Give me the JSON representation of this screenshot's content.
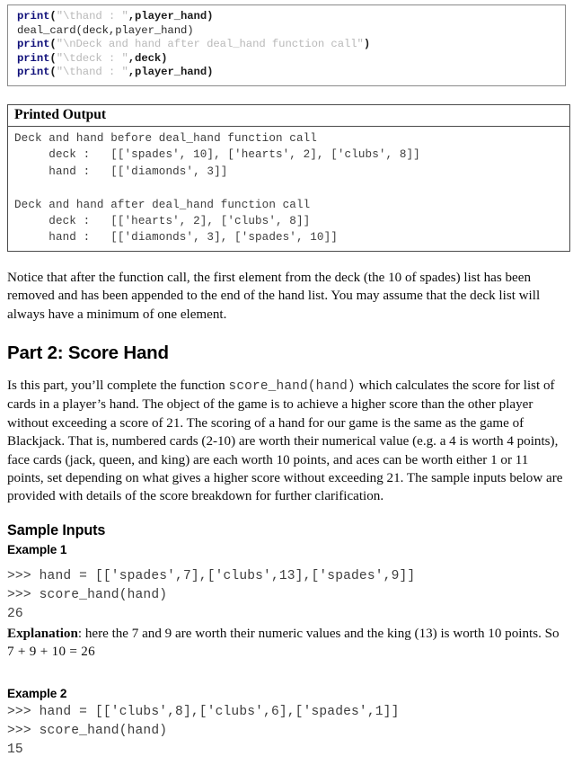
{
  "document": {
    "type": "programming-assignment-handout"
  },
  "code_block": {
    "name": "source-code-snippet",
    "lines": [
      {
        "segments": [
          {
            "text": "print",
            "style": "kw"
          },
          {
            "text": "(",
            "style": "plain"
          },
          {
            "text": "\"\\thand : \"",
            "style": "str"
          },
          {
            "text": ",player_hand)",
            "style": "plain"
          }
        ]
      },
      {
        "segments": [
          {
            "text": "deal_card(deck,player_hand)",
            "style": "plain-n"
          }
        ]
      },
      {
        "segments": [
          {
            "text": "print",
            "style": "kw"
          },
          {
            "text": "(",
            "style": "plain"
          },
          {
            "text": "\"\\nDeck and hand after deal_hand function call\"",
            "style": "str"
          },
          {
            "text": ")",
            "style": "plain"
          }
        ]
      },
      {
        "segments": [
          {
            "text": "print",
            "style": "kw"
          },
          {
            "text": "(",
            "style": "plain"
          },
          {
            "text": "\"\\tdeck : \"",
            "style": "str"
          },
          {
            "text": ",deck)",
            "style": "plain"
          }
        ]
      },
      {
        "segments": [
          {
            "text": "print",
            "style": "kw"
          },
          {
            "text": "(",
            "style": "plain"
          },
          {
            "text": "\"\\thand : \"",
            "style": "str"
          },
          {
            "text": ",player_hand)",
            "style": "plain"
          }
        ]
      }
    ]
  },
  "printed_output": {
    "header": "Printed Output",
    "lines": [
      "Deck and hand before deal_hand function call",
      "     deck :   [['spades', 10], ['hearts', 2], ['clubs', 8]]",
      "     hand :   [['diamonds', 3]]",
      "",
      "Deck and hand after deal_hand function call",
      "     deck :   [['hearts', 2], ['clubs', 8]]",
      "     hand :   [['diamonds', 3], ['spades', 10]]"
    ]
  },
  "notice_paragraph": "Notice that after the function call, the first element from the deck (the 10 of spades) list has been removed and has been appended to the end of the hand list. You may assume that the deck list will always have a minimum of one element.",
  "part2": {
    "heading": "Part 2: Score Hand",
    "intro_before_code": "Is this part, you’ll complete the function ",
    "inline_code": "score_hand(hand)",
    "intro_after_code": "  which calculates the score for list of cards in a player’s hand. The object of the game is to achieve a higher score than the other player without exceeding a score of 21. The scoring of a hand for our game is the same as the game of Blackjack. That is, numbered cards (2-10) are worth their numerical value (e.g. a 4 is worth 4 points), face cards (jack, queen, and king) are each worth 10 points, and aces can be worth either 1 or 11 points, set depending on what gives a higher score without exceeding 21. The sample inputs below are provided with details of the score breakdown for further clarification."
  },
  "sample_inputs": {
    "heading": "Sample Inputs",
    "examples": [
      {
        "title": "Example 1",
        "repl": [
          ">>> hand = [['spades',7],['clubs',13],['spades',9]]",
          ">>> score_hand(hand)",
          "26"
        ],
        "explanation_label": "Explanation",
        "explanation_text": ": here the 7 and 9 are worth their numeric values and the king (13) is worth 10 points. So ",
        "explanation_math": "7 + 9 + 10  =  26"
      },
      {
        "title": "Example 2",
        "repl": [
          ">>> hand = [['clubs',8],['clubs',6],['spades',1]]",
          ">>> score_hand(hand)",
          "15"
        ]
      }
    ]
  },
  "colors": {
    "keyword_blue": "#10107a",
    "string_gray": "#b9b9b9",
    "mono_text": "#3c3c3c",
    "body_text": "#0d0d0d",
    "border": "#4a4a4a",
    "code_border": "#8a8a8a"
  }
}
